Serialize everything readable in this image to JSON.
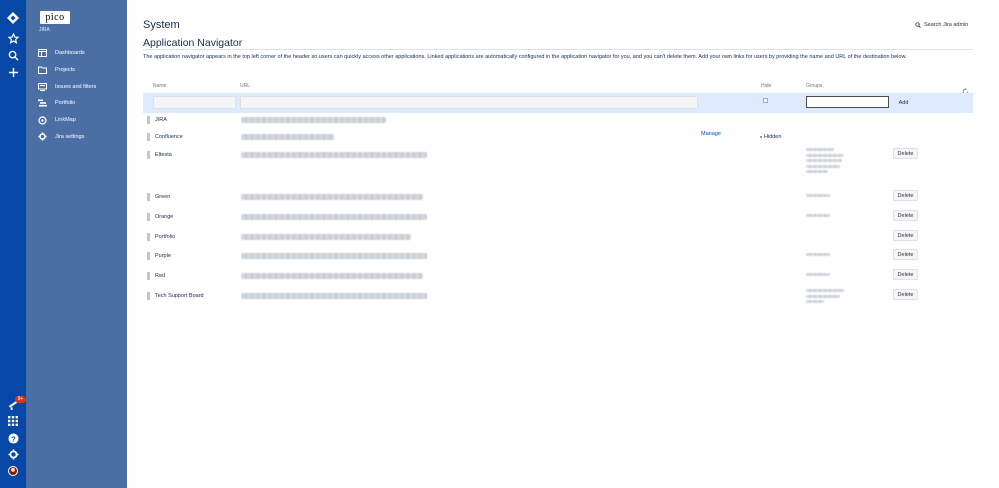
{
  "sidebar": {
    "logo_text": "pico",
    "project_name": "JIRA",
    "items": [
      {
        "label": "Dashboards",
        "icon": "dashboard-icon"
      },
      {
        "label": "Projects",
        "icon": "folder-icon"
      },
      {
        "label": "Issues and filters",
        "icon": "issues-icon"
      },
      {
        "label": "Portfolio",
        "icon": "portfolio-icon"
      },
      {
        "label": "LinkMap",
        "icon": "linkmap-icon"
      },
      {
        "label": "Jira settings",
        "icon": "gear-icon"
      }
    ]
  },
  "rail": {
    "notification_count": "9+",
    "colors": {
      "rail": "#0747a6",
      "sidebar": "#4b6fa5"
    }
  },
  "header": {
    "page_title": "System",
    "search_label": "Search Jira admin"
  },
  "navigator": {
    "title": "Application Navigator",
    "description": "The application navigator appears in the top left corner of the header so users can quickly access other applications. Linked applications are automatically configured in the application navigator for you, and you can't delete them. Add your own links for users by providing the name and URL of the destination below.",
    "columns": {
      "name": "Name",
      "url": "URL",
      "hide": "Hide",
      "groups": "Groups"
    },
    "add_button": "Add",
    "manage_label": "Manage",
    "hidden_label": "Hidden",
    "delete_label": "Delete",
    "rows": [
      {
        "name": "JIRA"
      },
      {
        "name": "Confluence"
      },
      {
        "name": "Eltesta"
      },
      {
        "name": "Green"
      },
      {
        "name": "Orange"
      },
      {
        "name": "Portfolio"
      },
      {
        "name": "Purple"
      },
      {
        "name": "Red"
      },
      {
        "name": "Tech Support Board"
      }
    ]
  }
}
